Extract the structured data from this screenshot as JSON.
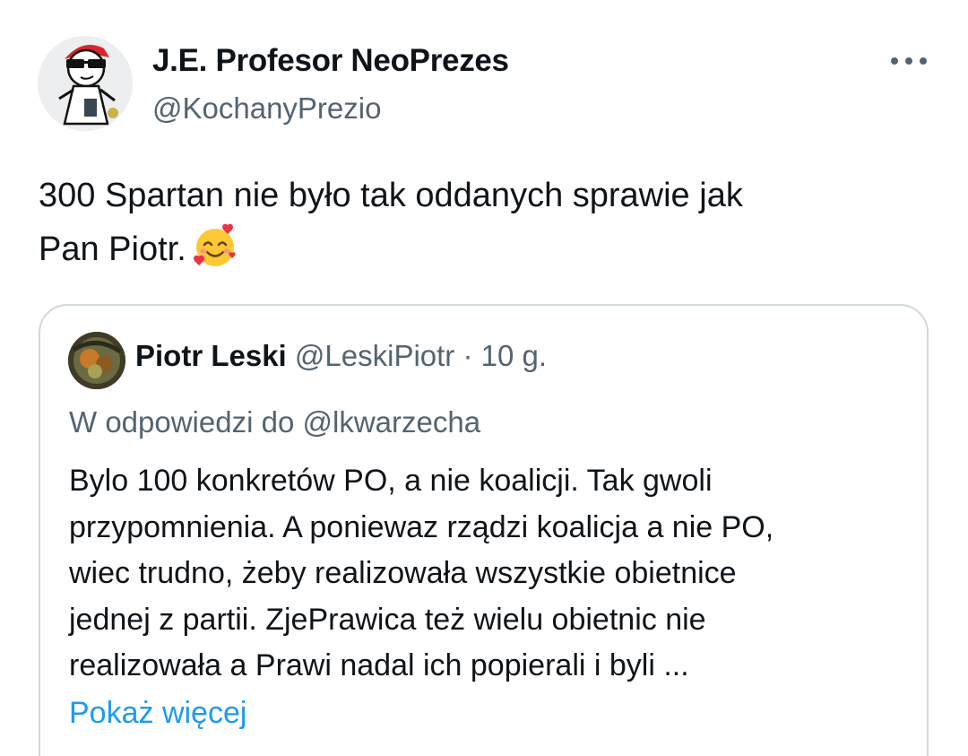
{
  "author": {
    "name": "J.E. Profesor NeoPrezes",
    "handle": "@KochanyPrezio",
    "avatar_icon": "cartoon-sunglasses-avatar-icon"
  },
  "menu": {
    "more_icon": "more-horizontal-icon"
  },
  "tweet": {
    "lines": [
      "300 Spartan nie było tak oddanych sprawie jak",
      "Pan Piotr."
    ],
    "emoji": "smiling-face-with-hearts-emoji"
  },
  "quote": {
    "avatar_icon": "user-photo-avatar-icon",
    "name": "Piotr Leski",
    "handle": "@LeskiPiotr",
    "separator": "·",
    "time": "10 g.",
    "reply_prefix": "W odpowiedzi do",
    "reply_mention": "@lkwarzecha",
    "body_lines": [
      "Bylo 100 konkretów PO, a nie koalicji. Tak gwoli",
      "przypomnienia. A poniewaz rządzi koalicja a nie PO,",
      "wiec trudno, żeby realizowała wszystkie obietnice",
      "jednej z partii. ZjePrawica też wielu obietnic nie",
      "realizowała a Prawi nadal ich popierali i byli ..."
    ],
    "show_more": "Pokaż więcej"
  },
  "colors": {
    "text_primary": "#0f1419",
    "text_secondary": "#536471",
    "link": "#1d9bf0",
    "border": "#cfd9de"
  }
}
